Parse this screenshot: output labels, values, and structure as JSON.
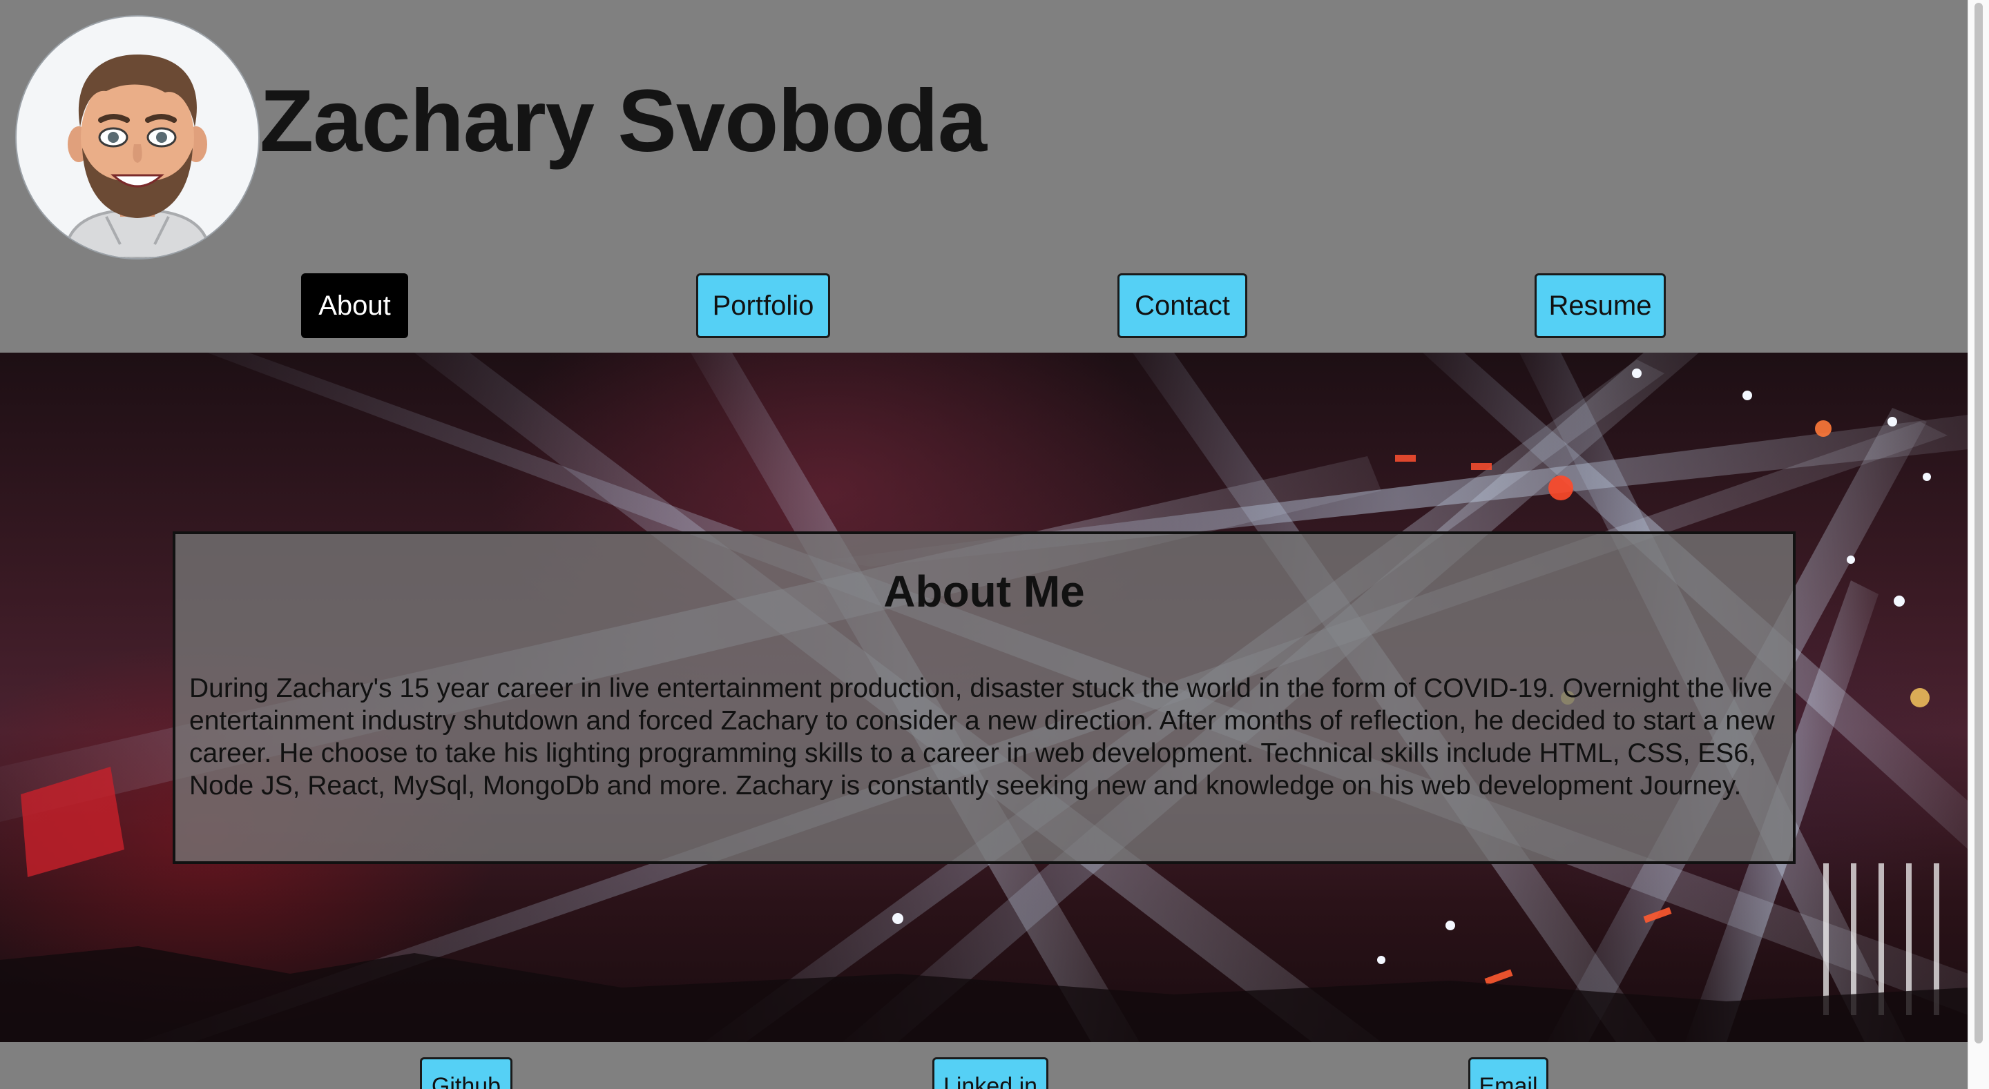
{
  "header": {
    "title": "Zachary Svoboda",
    "avatar_icon": "memoji-avatar-icon"
  },
  "nav": {
    "items": [
      {
        "label": "About",
        "active": true
      },
      {
        "label": "Portfolio",
        "active": false
      },
      {
        "label": "Contact",
        "active": false
      },
      {
        "label": "Resume",
        "active": false
      }
    ]
  },
  "about": {
    "title": "About Me",
    "text": "During Zachary's 15 year career in live entertainment production, disaster stuck the world in the form of COVID-19. Overnight the live entertainment industry shutdown and forced Zachary to consider a new direction. After months of reflection, he decided to start a new career. He choose to take his lighting programming skills to a career in web development. Technical skills include HTML, CSS, ES6, Node JS, React, MySql, MongoDb and more. Zachary is constantly seeking new and knowledge on his web development Journey."
  },
  "footer": {
    "links": [
      {
        "label": "Github"
      },
      {
        "label": "Linked in"
      },
      {
        "label": "Email"
      }
    ]
  },
  "colors": {
    "page_background": "#808080",
    "button_background": "#55d0f5",
    "active_button_background": "#000000",
    "hero_background": "concert stage lights photo"
  }
}
